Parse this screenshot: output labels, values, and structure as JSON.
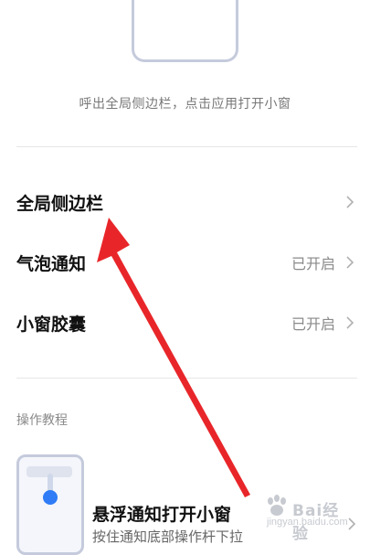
{
  "hint_text": "呼出全局侧边栏，点击应用打开小窗",
  "settings": [
    {
      "label": "全局侧边栏",
      "status": ""
    },
    {
      "label": "气泡通知",
      "status": "已开启"
    },
    {
      "label": "小窗胶囊",
      "status": "已开启"
    }
  ],
  "section_title": "操作教程",
  "tutorial": {
    "title": "悬浮通知打开小窗",
    "description": "按住通知底部操作杆下拉"
  },
  "watermark": {
    "text": "Bai经验",
    "url": "jingyan.baidu.com"
  },
  "colors": {
    "accent_blue": "#2f7cf6",
    "annotation_red": "#e8262a",
    "frame_gray": "#c5cbdc"
  }
}
